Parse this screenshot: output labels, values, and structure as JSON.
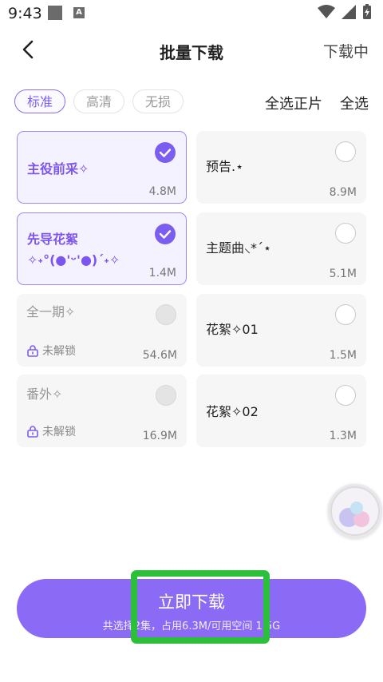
{
  "status_bar": {
    "time": "9:43"
  },
  "header": {
    "title": "批量下载",
    "right_link": "下载中"
  },
  "quality_tabs": [
    {
      "label": "标准",
      "active": true
    },
    {
      "label": "高清",
      "active": false
    },
    {
      "label": "无损",
      "active": false
    }
  ],
  "select_links": {
    "select_main": "全选正片",
    "select_all": "全选"
  },
  "items": [
    {
      "name": "主役前采✧",
      "size": "4.8M",
      "state": "selected"
    },
    {
      "name": "预告.⋆",
      "size": "8.9M",
      "state": "unselected"
    },
    {
      "name": "先导花絮\n✧˖°(●'ᵕ'●)ˊ˖✧",
      "size": "1.4M",
      "state": "selected"
    },
    {
      "name": "主题曲⸜*ˊ⋆",
      "size": "5.1M",
      "state": "unselected"
    },
    {
      "name": "全一期✧",
      "size": "54.6M",
      "state": "locked",
      "lock_text": "未解锁"
    },
    {
      "name": "花絮✧01",
      "size": "1.5M",
      "state": "unselected"
    },
    {
      "name": "番外✧",
      "size": "16.9M",
      "state": "locked",
      "lock_text": "未解锁"
    },
    {
      "name": "花絮✧02",
      "size": "1.3M",
      "state": "unselected"
    }
  ],
  "download_button": {
    "label": "立即下载",
    "summary": "共选择2集，占用6.3M/可用空间 1.5G"
  },
  "colors": {
    "accent": "#7b5ef0",
    "highlight": "#2bbf3a"
  }
}
